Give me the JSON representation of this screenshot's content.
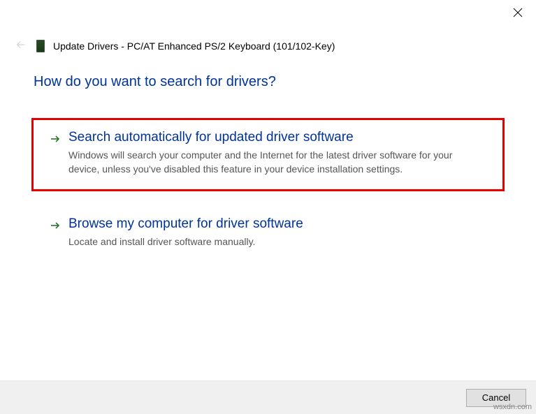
{
  "window": {
    "title": "Update Drivers - PC/AT Enhanced PS/2 Keyboard (101/102-Key)"
  },
  "heading": "How do you want to search for drivers?",
  "options": [
    {
      "title": "Search automatically for updated driver software",
      "description": "Windows will search your computer and the Internet for the latest driver software for your device, unless you've disabled this feature in your device installation settings."
    },
    {
      "title": "Browse my computer for driver software",
      "description": "Locate and install driver software manually."
    }
  ],
  "footer": {
    "cancel_label": "Cancel"
  },
  "watermark": "wsxdn.com"
}
